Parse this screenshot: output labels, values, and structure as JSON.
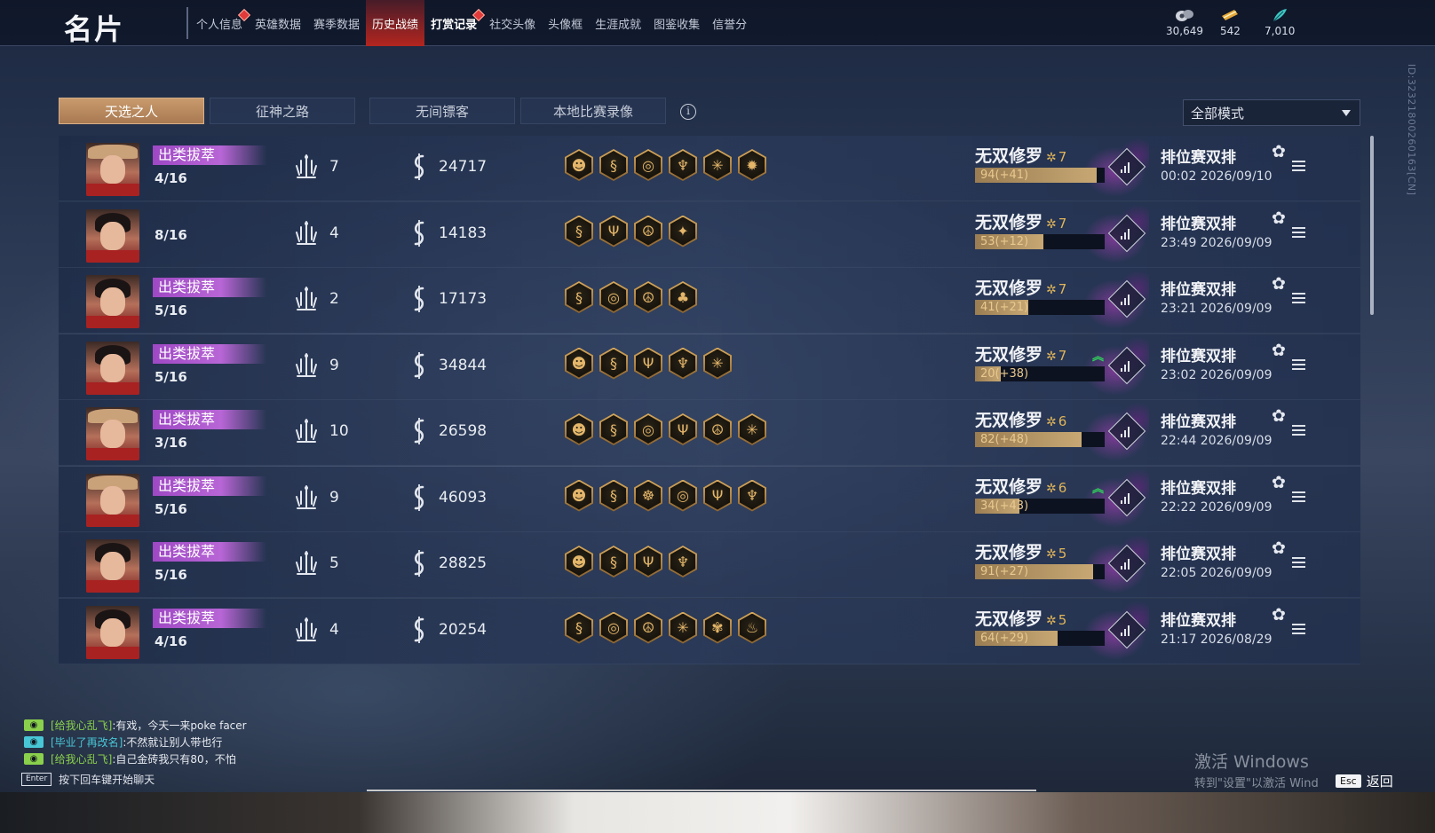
{
  "header": {
    "title": "名片",
    "nav_tabs": [
      {
        "label": "个人信息",
        "dot": true
      },
      {
        "label": "英雄数据"
      },
      {
        "label": "赛季数据"
      },
      {
        "label": "历史战绩",
        "active": true
      },
      {
        "label": "打赏记录",
        "dot": true,
        "bold": true
      },
      {
        "label": "社交头像"
      },
      {
        "label": "头像框"
      },
      {
        "label": "生涯成就"
      },
      {
        "label": "图鉴收集"
      },
      {
        "label": "信誉分"
      }
    ],
    "currencies": [
      {
        "icon": "coin-bag-icon",
        "value": "30,649"
      },
      {
        "icon": "ticket-icon",
        "value": "542"
      },
      {
        "icon": "feather-icon",
        "value": "7,010"
      }
    ],
    "player_id": "ID:3232180026016​3[CN]"
  },
  "subtabs": {
    "items": [
      "天选之人",
      "征神之路",
      "无间镖客",
      "本地比赛录像"
    ],
    "active_index": 0
  },
  "mode_filter": {
    "value": "全部模式"
  },
  "matches": [
    {
      "badge": "出类拔萃",
      "rank": "4/16",
      "avatar": "hat",
      "kills": "7",
      "damage": "24717",
      "traits": [
        "☻",
        "§",
        "◎",
        "♆",
        "✳",
        "✹"
      ],
      "tier": "无双修罗",
      "tier_level": "7",
      "lp": "94(+41)",
      "lp_fill": 0.94,
      "up": false,
      "mode": "排位赛双排",
      "time": "00:02  2026/09/10"
    },
    {
      "badge": "",
      "rank": "8/16",
      "avatar": "plain",
      "kills": "4",
      "damage": "14183",
      "traits": [
        "§",
        "Ψ",
        "☮",
        "✦"
      ],
      "tier": "无双修罗",
      "tier_level": "7",
      "lp": "53(+12)",
      "lp_fill": 0.53,
      "up": false,
      "mode": "排位赛双排",
      "time": "23:49  2026/09/09"
    },
    {
      "badge": "出类拔萃",
      "rank": "5/16",
      "avatar": "plain",
      "kills": "2",
      "damage": "17173",
      "traits": [
        "§",
        "◎",
        "☮",
        "♣"
      ],
      "tier": "无双修罗",
      "tier_level": "7",
      "lp": "41(+21)",
      "lp_fill": 0.41,
      "up": false,
      "mode": "排位赛双排",
      "time": "23:21  2026/09/09"
    },
    {
      "badge": "出类拔萃",
      "rank": "5/16",
      "avatar": "plain",
      "kills": "9",
      "damage": "34844",
      "traits": [
        "☻",
        "§",
        "Ψ",
        "♆",
        "✳"
      ],
      "tier": "无双修罗",
      "tier_level": "7",
      "lp": "20(+38)",
      "lp_fill": 0.2,
      "up": true,
      "mode": "排位赛双排",
      "time": "23:02  2026/09/09"
    },
    {
      "badge": "出类拔萃",
      "rank": "3/16",
      "avatar": "hat",
      "kills": "10",
      "damage": "26598",
      "traits": [
        "☻",
        "§",
        "◎",
        "Ψ",
        "☮",
        "✳"
      ],
      "tier": "无双修罗",
      "tier_level": "6",
      "lp": "82(+48)",
      "lp_fill": 0.82,
      "up": false,
      "mode": "排位赛双排",
      "time": "22:44  2026/09/09"
    },
    {
      "badge": "出类拔萃",
      "rank": "5/16",
      "avatar": "hat",
      "kills": "9",
      "damage": "46093",
      "traits": [
        "☻",
        "§",
        "☸",
        "◎",
        "Ψ",
        "♆"
      ],
      "tier": "无双修罗",
      "tier_level": "6",
      "lp": "34(+43)",
      "lp_fill": 0.34,
      "up": true,
      "mode": "排位赛双排",
      "time": "22:22  2026/09/09"
    },
    {
      "badge": "出类拔萃",
      "rank": "5/16",
      "avatar": "plain",
      "kills": "5",
      "damage": "28825",
      "traits": [
        "☻",
        "§",
        "Ψ",
        "♆"
      ],
      "tier": "无双修罗",
      "tier_level": "5",
      "lp": "91(+27)",
      "lp_fill": 0.91,
      "up": false,
      "mode": "排位赛双排",
      "time": "22:05  2026/09/09"
    },
    {
      "badge": "出类拔萃",
      "rank": "4/16",
      "avatar": "plain",
      "kills": "4",
      "damage": "20254",
      "traits": [
        "§",
        "◎",
        "☮",
        "✳",
        "✾",
        "♨"
      ],
      "tier": "无双修罗",
      "tier_level": "5",
      "lp": "64(+29)",
      "lp_fill": 0.64,
      "up": false,
      "mode": "排位赛双排",
      "time": "21:17  2026/08/29"
    }
  ],
  "chat": {
    "lines": [
      {
        "name": "[给我心乱飞]",
        "name_color": "green",
        "text": ":有戏，今天一来poke facer"
      },
      {
        "name": "[毕业了再改名]",
        "name_color": "cyan",
        "text": ":不然就让别人带也行"
      },
      {
        "name": "[给我心乱飞]",
        "name_color": "green",
        "text": ":自己金砖我只有80，不怕"
      }
    ],
    "enter_key": "Enter",
    "enter_hint": "按下回车键开始聊天"
  },
  "watermark": {
    "line1": "激活 Windows",
    "line2": "转到\"设置\"以激活 Wind"
  },
  "back": {
    "key": "Esc",
    "label": "返回"
  },
  "colors": {
    "accent_tab": "#b3251f",
    "badge_purple": "#b866d6",
    "gold": "#e0b45a",
    "up_green": "#2ed35a"
  }
}
